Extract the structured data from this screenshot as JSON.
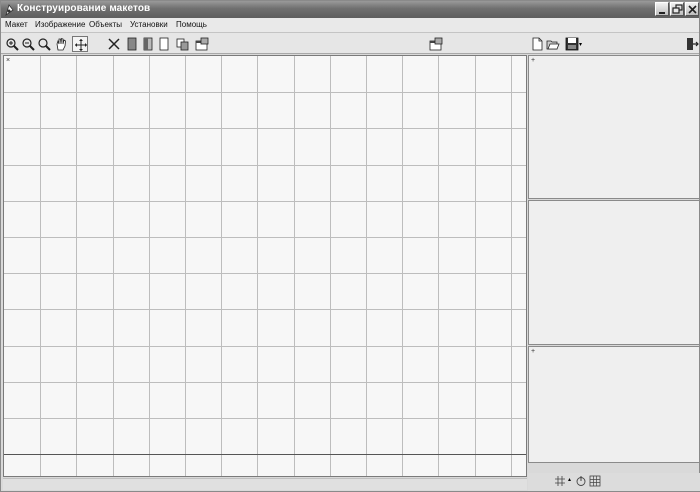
{
  "window": {
    "title": "Конструирование макетов"
  },
  "menu": {
    "items": [
      "Макет",
      "Изображение",
      "Объекты",
      "Установки",
      "Помощь"
    ]
  },
  "toolbar": {
    "left_icons": [
      "zoom-in-icon",
      "zoom-out-icon",
      "zoom-fit-icon",
      "pan-hand-icon",
      "move-arrows-icon",
      "delete-cross-icon",
      "page-icon",
      "page-icon",
      "page-icon",
      "copy-icon",
      "properties-icon"
    ],
    "center_icons": [
      "settings-window-icon"
    ],
    "right_icons": [
      "new-file-icon",
      "open-folder-icon",
      "save-disk-icon",
      "exit-door-icon"
    ],
    "dropdown_arrow": "▾"
  },
  "canvas": {
    "corner_mark": "×",
    "grid_columns": 14,
    "grid_rows": 11
  },
  "panels": {
    "panel1_mark": "+",
    "panel3_mark": "+"
  },
  "bottom_toolbar": {
    "icons": [
      "grid-snap-icon",
      "up-arrow-icon",
      "power-icon",
      "grid-icon"
    ],
    "arrow": "▴"
  },
  "colors": {
    "titlebar": "#6f6f6f",
    "grid_line": "#bdbdbd",
    "canvas_bg": "#f7f7f7"
  }
}
